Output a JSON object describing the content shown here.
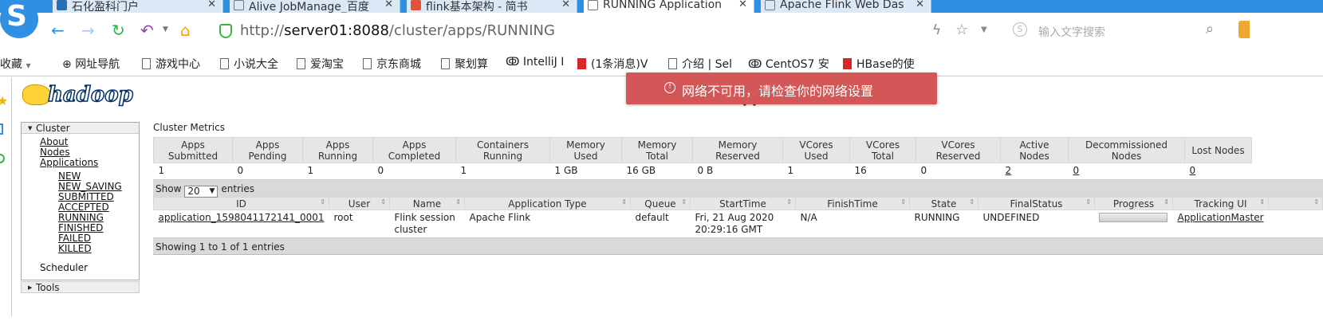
{
  "browser": {
    "tabs": [
      {
        "label": "石化盈科门户",
        "icon_color": "#2a6fb5"
      },
      {
        "label": "Alive JobManage_百度",
        "icon_color": "#ffffff"
      },
      {
        "label": "flink基本架构 - 简书",
        "icon_color": "#e0533f"
      },
      {
        "label": "RUNNING Application",
        "icon_color": "#ffffff"
      },
      {
        "label": "Apache Flink Web Das",
        "icon_color": "#ffffff"
      }
    ],
    "url_prefix": "http://",
    "url_host": "server01:8088",
    "url_path": "/cluster/apps/RUNNING",
    "search_placeholder": "输入文字搜索",
    "bookmarks": [
      "收藏",
      "网址导航",
      "游戏中心",
      "小说大全",
      "爱淘宝",
      "京东商城",
      "聚划算",
      "IntelliJ I",
      "(1条消息)V",
      "介绍 | Sel",
      "CentOS7 安",
      "HBase的使"
    ]
  },
  "toast": {
    "message": "网络不可用，请检查你的网络设置"
  },
  "page": {
    "logo_text": "hadoop",
    "heading": "RUNNING Applications"
  },
  "nav": {
    "cluster_label": "Cluster",
    "links": [
      "About",
      "Nodes",
      "Applications"
    ],
    "states": [
      "NEW",
      "NEW_SAVING",
      "SUBMITTED",
      "ACCEPTED",
      "RUNNING",
      "FINISHED",
      "FAILED",
      "KILLED"
    ],
    "scheduler": "Scheduler",
    "tools_label": "Tools"
  },
  "metrics": {
    "title": "Cluster Metrics",
    "headers": [
      "Apps Submitted",
      "Apps Pending",
      "Apps Running",
      "Apps Completed",
      "Containers Running",
      "Memory Used",
      "Memory Total",
      "Memory Reserved",
      "VCores Used",
      "VCores Total",
      "VCores Reserved",
      "Active Nodes",
      "Decommissioned Nodes",
      "Lost Nodes"
    ],
    "values": [
      "1",
      "0",
      "1",
      "0",
      "1",
      "1 GB",
      "16 GB",
      "0 B",
      "1",
      "16",
      "0",
      "2",
      "0",
      "0"
    ]
  },
  "apps": {
    "show_label": "Show",
    "page_size": "20",
    "entries_label": "entries",
    "headers": [
      "ID",
      "User",
      "Name",
      "Application Type",
      "Queue",
      "StartTime",
      "FinishTime",
      "State",
      "FinalStatus",
      "Progress",
      "Tracking UI"
    ],
    "rows": [
      {
        "id": "application_1598041172141_0001",
        "user": "root",
        "name": "Flink session cluster",
        "type": "Apache Flink",
        "queue": "default",
        "start": "Fri, 21 Aug 2020 20:29:16 GMT",
        "finish": "N/A",
        "state": "RUNNING",
        "final_status": "UNDEFINED",
        "progress": 0,
        "tracking": "ApplicationMaster"
      }
    ],
    "footer": "Showing 1 to 1 of 1 entries"
  }
}
